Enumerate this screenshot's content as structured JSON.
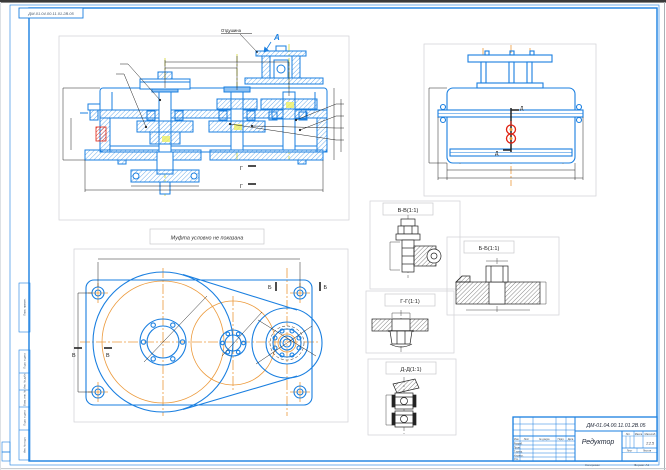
{
  "page": {
    "corner_stamp": "ДМ-01.04.00.11.01.2В.05",
    "copied": "Копировал",
    "format": "Формат А1"
  },
  "colors": {
    "line_blue": "#1a7fe0",
    "centerline_orange": "#ec9a3c",
    "centerline_yellow": "#d2d435",
    "accent_red": "#e02010",
    "drawing_black": "#222222",
    "frame_gray": "#d0d0d4"
  },
  "annotations": {
    "note": "Муфта условно не показана",
    "callout": "Отдушина",
    "view_a": "А",
    "mark_b": "Б",
    "mark_v": "В",
    "mark_g": "Г",
    "mark_d": "Д"
  },
  "sections": {
    "vv": "В-В(1:1)",
    "bb": "Б-Б(1:1)",
    "gg": "Г-Г(1:1)",
    "dd": "Д-Д(1:1)"
  },
  "margin": {
    "m0": "Перв. примен.",
    "m1": "Подп. и дата",
    "m2": "Инв. № дубл.",
    "m3": "Взам. инв. №",
    "m4": "Подп. и дата",
    "m5": "Инв. № подл."
  },
  "title": {
    "number": "ДМ-01.04.00.11.01.2В.05",
    "name": "Редуктор",
    "scale": "1:2.5",
    "lit_label": "Лит.",
    "mass_label": "Масса",
    "scale_label": "Масштаб",
    "sheet_label": "Лист",
    "sheets_label": "Листов",
    "col_izm": "Изм.",
    "col_list": "Лист",
    "col_doc": "№ докум.",
    "col_sign": "Подп.",
    "col_date": "Дата",
    "row_dev": "Разраб.",
    "row_check": "Пров.",
    "row_tcontrol": "Т.контр.",
    "row_ncontrol": "Н.контр.",
    "row_approve": "Утв."
  }
}
